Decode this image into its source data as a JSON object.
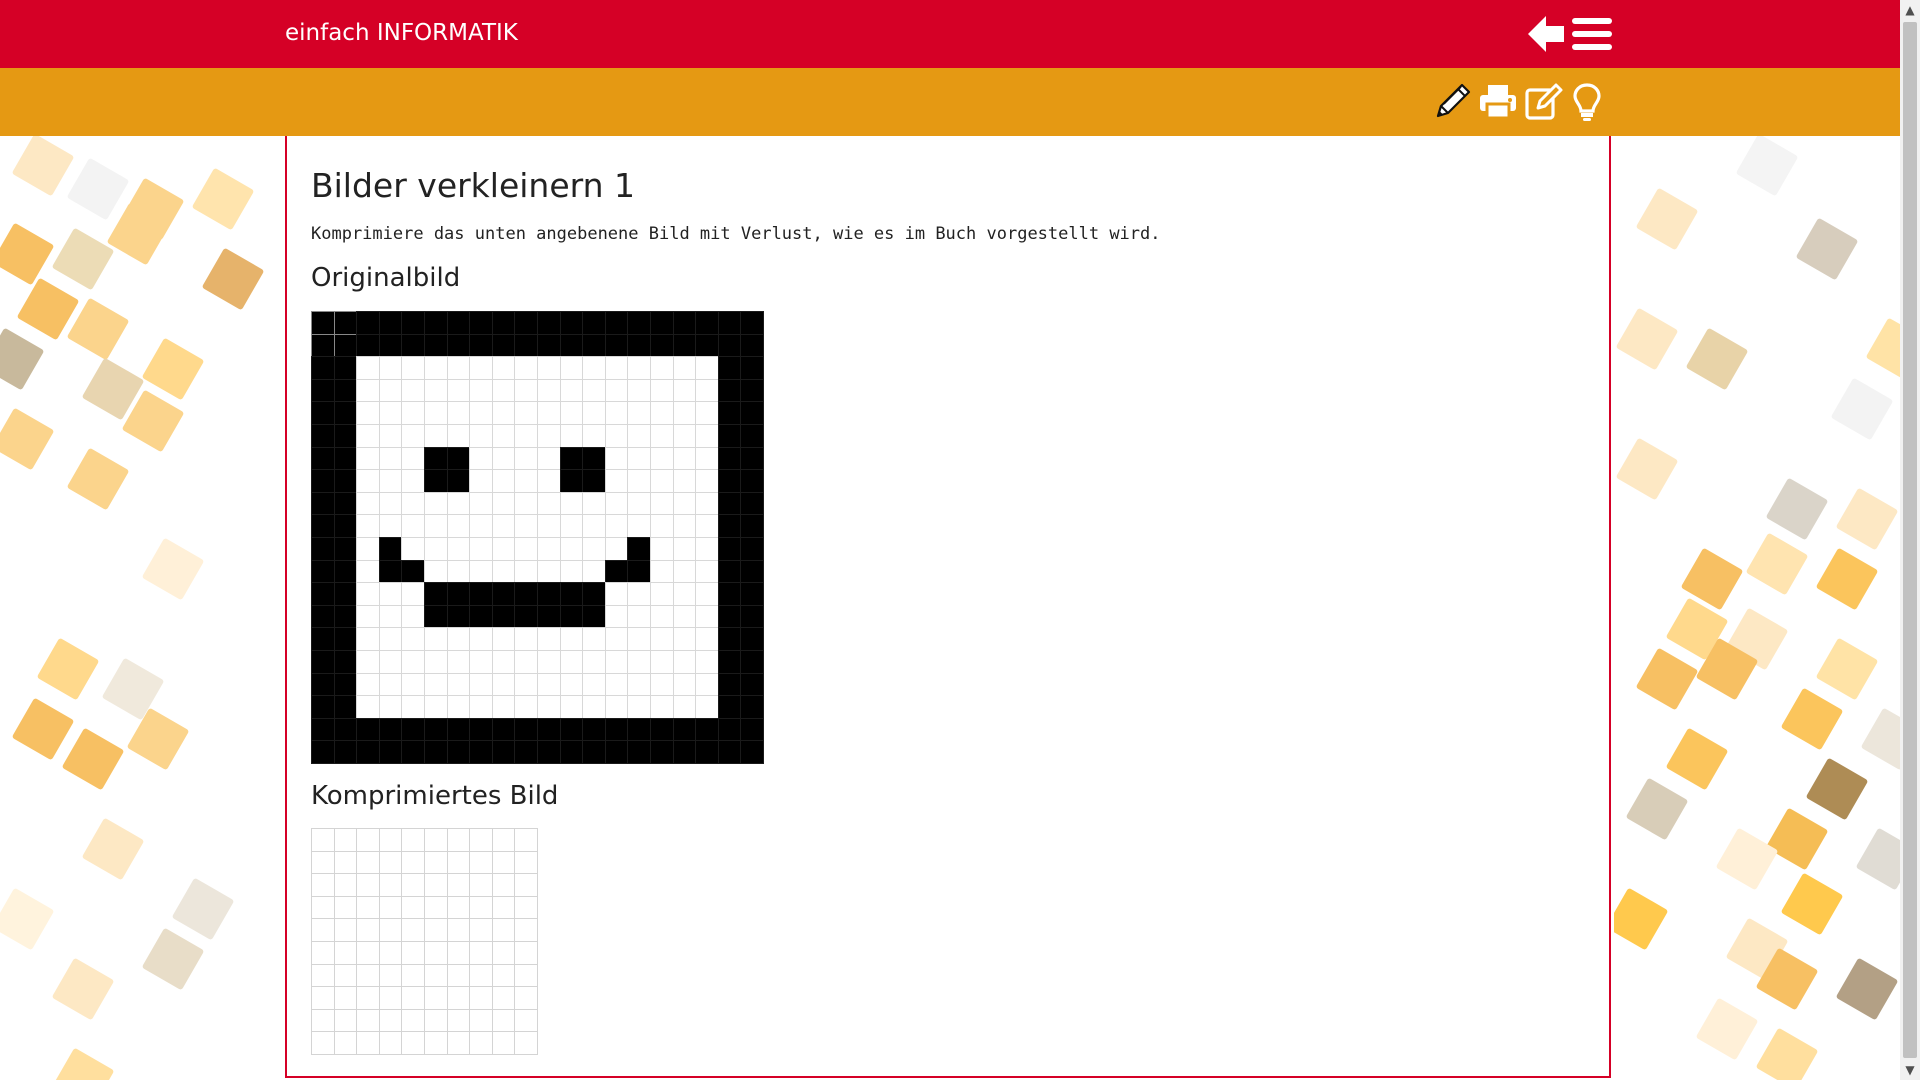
{
  "header": {
    "brand": "einfach INFORMATIK",
    "back_icon": "arrow-left-icon",
    "menu_icon": "hamburger-menu-icon",
    "color": "#d50026"
  },
  "toolbar": {
    "color": "#e59913",
    "icons": [
      "pencil-icon",
      "printer-icon",
      "edit-note-icon",
      "lightbulb-icon"
    ]
  },
  "main": {
    "title": "Bilder verkleinern 1",
    "intro": "Komprimiere das unten angebenene Bild mit Verlust, wie es im Buch vorgestellt wird.",
    "original_heading": "Originalbild",
    "compressed_heading": "Komprimiertes Bild"
  },
  "original_image": {
    "size": 20,
    "rows": [
      "11111111111111111111",
      "11111111111111111111",
      "11000000000000000011",
      "11000000000000000011",
      "11000000000000000011",
      "11000000000000000011",
      "11000110000110000011",
      "11000110000110000011",
      "11000000000000000011",
      "11000000000000000011",
      "11010000000000100011",
      "11011000000001100011",
      "11000111111110000011",
      "11000111111110000011",
      "11000000000000000011",
      "11000000000000000011",
      "11000000000000000011",
      "11000000000000000011",
      "11111111111111111111",
      "11111111111111111111"
    ]
  },
  "compressed_image": {
    "size": 10,
    "rows": [
      "0000000000",
      "0000000000",
      "0000000000",
      "0000000000",
      "0000000000",
      "0000000000",
      "0000000000",
      "0000000000",
      "0000000000",
      "0000000000"
    ]
  }
}
